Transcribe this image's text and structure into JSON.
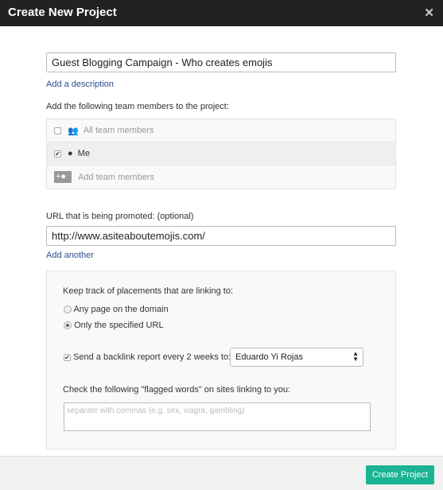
{
  "header": {
    "title": "Create New Project",
    "close_icon": "close-icon"
  },
  "form": {
    "project_name": "Guest Blogging Campaign - Who creates emojis",
    "add_description": "Add a description",
    "team_label": "Add the following team members to the project:",
    "team": [
      {
        "label": "All team members",
        "checked": false,
        "icon": "users-icon"
      },
      {
        "label": "Me",
        "checked": true,
        "icon": "user-icon"
      },
      {
        "label": "Add team members",
        "icon": "add-user-icon"
      }
    ],
    "url_label": "URL that is being promoted: (optional)",
    "url_value": "http://www.asiteaboutemojis.com/",
    "add_another": "Add another",
    "track_label": "Keep track of placements that are linking to:",
    "radio_any": "Any page on the domain",
    "radio_only": "Only the specified URL",
    "selected_radio": "Only the specified URL",
    "report_label": "Send a backlink report every 2 weeks to:",
    "report_checked": true,
    "report_recipient": "Eduardo Yi Rojas",
    "flagged_label": "Check the following \"flagged words\" on sites linking to you:",
    "flagged_placeholder": "separate with commas (e.g. sex, viagra, gambling)"
  },
  "footer": {
    "create_button": "Create Project",
    "accent": "#1ab394"
  }
}
